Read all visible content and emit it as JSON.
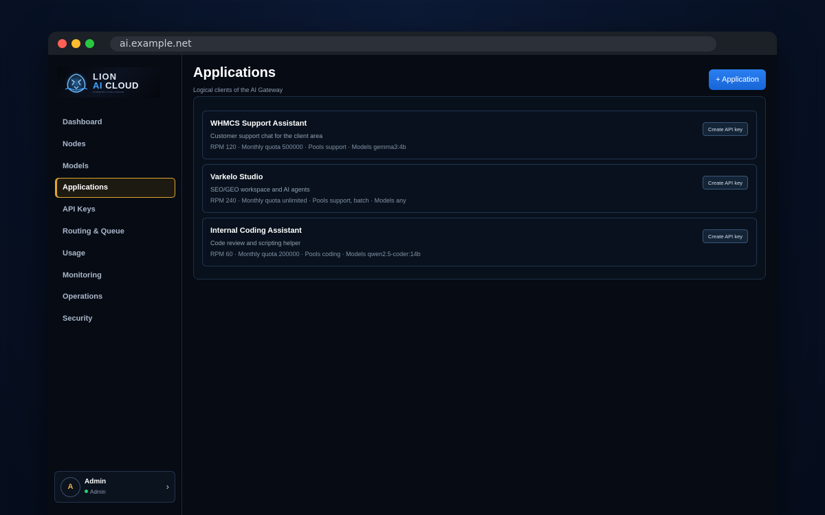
{
  "browser": {
    "url": "ai.example.net"
  },
  "brand": {
    "line1": "LION",
    "line2_ai": "AI",
    "line2_rest": " CLOUD",
    "tagline": "POWERING INTELLIGENCE"
  },
  "sidebar": {
    "items": [
      {
        "label": "Dashboard",
        "active": false
      },
      {
        "label": "Nodes",
        "active": false
      },
      {
        "label": "Models",
        "active": false
      },
      {
        "label": "Applications",
        "active": true
      },
      {
        "label": "API Keys",
        "active": false
      },
      {
        "label": "Routing & Queue",
        "active": false
      },
      {
        "label": "Usage",
        "active": false
      },
      {
        "label": "Monitoring",
        "active": false
      },
      {
        "label": "Operations",
        "active": false
      },
      {
        "label": "Security",
        "active": false
      }
    ]
  },
  "user": {
    "initial": "A",
    "name": "Admin",
    "role": "Admin",
    "status_color": "#2ad16b"
  },
  "page": {
    "title": "Applications",
    "subtitle": "Logical clients of the AI Gateway",
    "add_button_label": "+ Application"
  },
  "applications": [
    {
      "name": "WHMCS Support Assistant",
      "description": "Customer support chat for the client area",
      "meta": "RPM 120 · Monthly quota 500000 · Pools support · Models gemma3:4b",
      "action_label": "Create API key"
    },
    {
      "name": "Varkelo Studio",
      "description": "SEO/GEO workspace and AI agents",
      "meta": "RPM 240 · Monthly quota unlimited · Pools support, batch · Models any",
      "action_label": "Create API key"
    },
    {
      "name": "Internal Coding Assistant",
      "description": "Code review and scripting helper",
      "meta": "RPM 60 · Monthly quota 200000 · Pools coding · Models qwen2.5-coder:14b",
      "action_label": "Create API key"
    }
  ],
  "colors": {
    "accent": "#e3a72f",
    "primary": "#1e73e3",
    "brand_blue": "#3ea2ff"
  }
}
